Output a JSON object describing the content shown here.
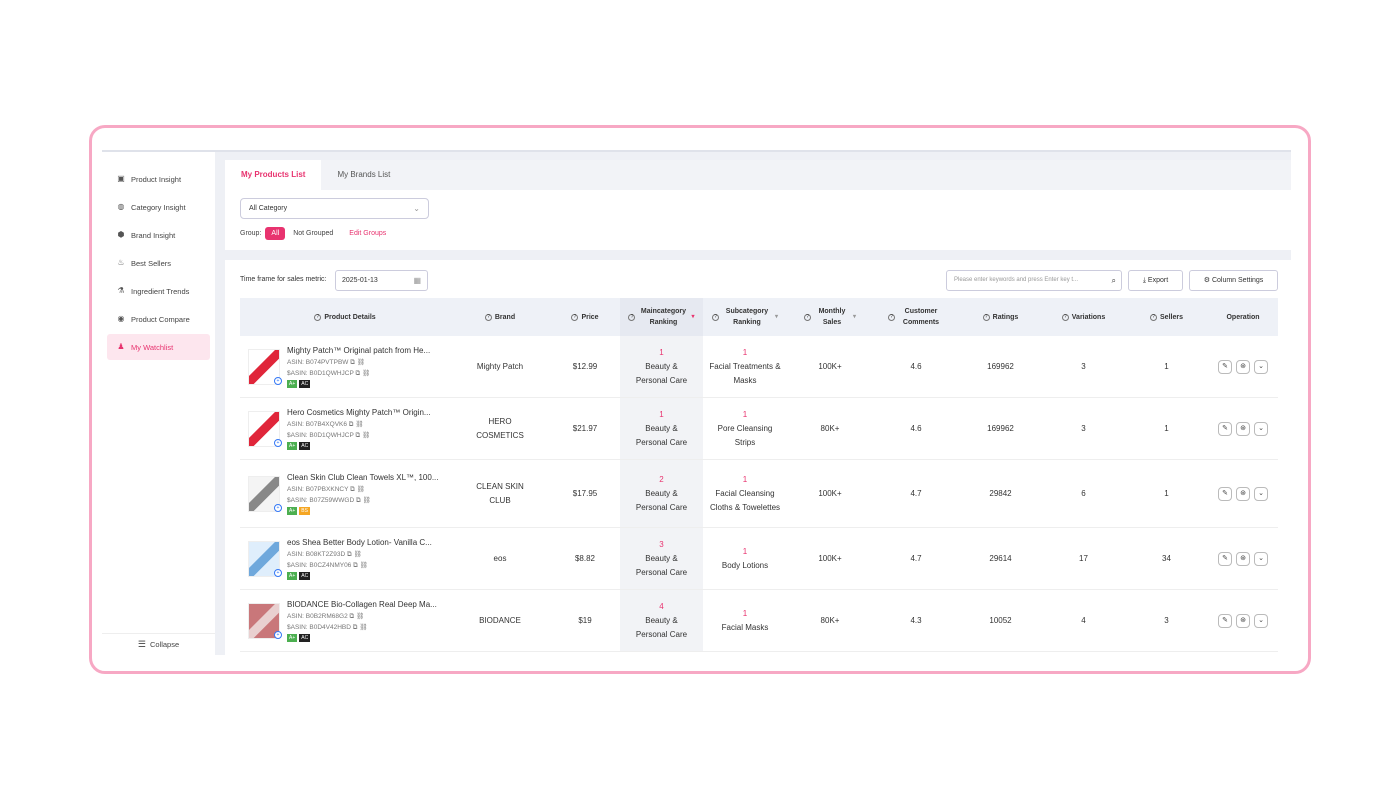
{
  "sidebar": {
    "items": [
      {
        "label": "Product Insight",
        "icon": "product-icon"
      },
      {
        "label": "Category Insight",
        "icon": "category-icon"
      },
      {
        "label": "Brand Insight",
        "icon": "brand-icon"
      },
      {
        "label": "Best Sellers",
        "icon": "fire-icon"
      },
      {
        "label": "Ingredient Trends",
        "icon": "flask-icon"
      },
      {
        "label": "Product Compare",
        "icon": "compare-icon"
      },
      {
        "label": "My Watchlist",
        "icon": "user-heart-icon",
        "active": true
      }
    ],
    "collapse_label": "Collapse"
  },
  "tabs": [
    {
      "label": "My Products List",
      "active": true
    },
    {
      "label": "My Brands List",
      "active": false
    }
  ],
  "filters": {
    "category_value": "All Category",
    "group_label": "Group:",
    "group_all": "All",
    "group_not_grouped": "Not Grouped",
    "edit_groups": "Edit Groups"
  },
  "toolbar": {
    "timeframe_label": "Time frame for sales metric:",
    "date_value": "2025-01-13",
    "search_placeholder": "Please enter keywords and press Enter key t...",
    "export_label": "Export",
    "column_settings_label": "Column Settings"
  },
  "columns": {
    "product": "Product Details",
    "brand": "Brand",
    "price": "Price",
    "main_rank": "Maincategory Ranking",
    "sub_rank": "Subcategory Ranking",
    "monthly": "Monthly Sales",
    "comments": "Customer Comments",
    "ratings": "Ratings",
    "variations": "Variations",
    "sellers": "Sellers",
    "operation": "Operation"
  },
  "rows": [
    {
      "title": "Mighty Patch™ Original patch from He...",
      "asin": "ASIN: B074PVTPBW",
      "sasin": "$ASIN: B0D1QWHJCP",
      "badges": [
        "A+",
        "AC"
      ],
      "brand": "Mighty Patch",
      "price": "$12.99",
      "main_rank": "1",
      "main_cat": "Beauty & Personal Care",
      "sub_rank": "1",
      "sub_cat": "Facial Treatments & Masks",
      "monthly": "100K+",
      "comments": "4.6",
      "ratings": "169962",
      "variations": "3",
      "sellers": "1"
    },
    {
      "title": "Hero Cosmetics Mighty Patch™ Origin...",
      "asin": "ASIN: B07B4XQVK6",
      "sasin": "$ASIN: B0D1QWHJCP",
      "badges": [
        "A+",
        "AC"
      ],
      "brand": "HERO COSMETICS",
      "price": "$21.97",
      "main_rank": "1",
      "main_cat": "Beauty & Personal Care",
      "sub_rank": "1",
      "sub_cat": "Pore Cleansing Strips",
      "monthly": "80K+",
      "comments": "4.6",
      "ratings": "169962",
      "variations": "3",
      "sellers": "1"
    },
    {
      "title": "Clean Skin Club Clean Towels XL™, 100...",
      "asin": "ASIN: B07PBXKNCY",
      "sasin": "$ASIN: B07Z59WWGD",
      "badges": [
        "A+",
        "BS"
      ],
      "brand": "CLEAN SKIN CLUB",
      "price": "$17.95",
      "main_rank": "2",
      "main_cat": "Beauty & Personal Care",
      "sub_rank": "1",
      "sub_cat": "Facial Cleansing Cloths & Towelettes",
      "monthly": "100K+",
      "comments": "4.7",
      "ratings": "29842",
      "variations": "6",
      "sellers": "1"
    },
    {
      "title": "eos Shea Better Body Lotion- Vanilla C...",
      "asin": "ASIN: B08KT2Z93D",
      "sasin": "$ASIN: B0CZ4NMY06",
      "badges": [
        "A+",
        "AC"
      ],
      "brand": "eos",
      "price": "$8.82",
      "main_rank": "3",
      "main_cat": "Beauty & Personal Care",
      "sub_rank": "1",
      "sub_cat": "Body Lotions",
      "monthly": "100K+",
      "comments": "4.7",
      "ratings": "29614",
      "variations": "17",
      "sellers": "34"
    },
    {
      "title": "BIODANCE Bio-Collagen Real Deep Ma...",
      "asin": "ASIN: B0B2RM68G2",
      "sasin": "$ASIN: B0D4V42HBD",
      "badges": [
        "A+",
        "AC"
      ],
      "brand": "BIODANCE",
      "price": "$19",
      "main_rank": "4",
      "main_cat": "Beauty & Personal Care",
      "sub_rank": "1",
      "sub_cat": "Facial Masks",
      "monthly": "80K+",
      "comments": "4.3",
      "ratings": "10052",
      "variations": "4",
      "sellers": "3"
    }
  ],
  "colors": {
    "accent": "#e8336f",
    "frame_border": "#f7a8c4"
  }
}
